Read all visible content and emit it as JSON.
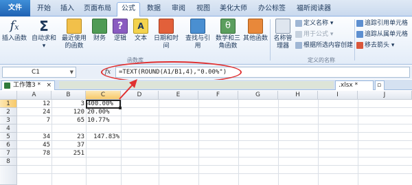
{
  "ribbon_tabs": [
    "文件",
    "开始",
    "插入",
    "页面布局",
    "公式",
    "数据",
    "审阅",
    "视图",
    "美化大师",
    "办公标签",
    "福昕阅读器"
  ],
  "active_tab": "公式",
  "ribbon": {
    "buttons": [
      {
        "label": "插入函数",
        "icon": "fx-icon"
      },
      {
        "label": "自动求和",
        "icon": "sigma-icon"
      },
      {
        "label": "最近使用的函数",
        "icon": "star-book-icon"
      },
      {
        "label": "财务",
        "icon": "money-book-icon"
      },
      {
        "label": "逻辑",
        "icon": "question-book-icon"
      },
      {
        "label": "文本",
        "icon": "text-book-icon"
      },
      {
        "label": "日期和时间",
        "icon": "clock-book-icon"
      },
      {
        "label": "查找与引用",
        "icon": "search-book-icon"
      },
      {
        "label": "数学和三角函数",
        "icon": "theta-book-icon"
      },
      {
        "label": "其他函数",
        "icon": "more-book-icon"
      },
      {
        "label": "名称管理器",
        "icon": "name-manager-icon"
      }
    ],
    "group_function_library": "函数库",
    "group_defined_names": "定义的名称",
    "define_name": "定义名称",
    "use_in_formula": "用于公式",
    "create_from_selection": "根据所选内容创建",
    "trace_precedents": "追踪引用单元格",
    "trace_dependents": "追踪从属单元格",
    "remove_arrows": "移去箭头"
  },
  "formula_bar": {
    "name_box": "C1",
    "fx_label": "fx",
    "formula": "=TEXT(ROUND(A1/B1,4),\"0.00%\")"
  },
  "workbook_tabs": [
    {
      "label": "工作簿3 *"
    },
    {
      "label": ".xlsx *"
    }
  ],
  "sheet": {
    "columns": [
      "A",
      "B",
      "C",
      "D",
      "E",
      "F",
      "G",
      "H",
      "I",
      "J"
    ],
    "rows": [
      "1",
      "2",
      "3",
      "4",
      "5",
      "6",
      "7",
      "8"
    ],
    "cells": [
      {
        "ref": "A1",
        "value": "12"
      },
      {
        "ref": "B1",
        "value": "3"
      },
      {
        "ref": "C1",
        "value": "400.00%"
      },
      {
        "ref": "A2",
        "value": "24"
      },
      {
        "ref": "B2",
        "value": "120"
      },
      {
        "ref": "C2",
        "value": "20.00%"
      },
      {
        "ref": "A3",
        "value": "7"
      },
      {
        "ref": "B3",
        "value": "65"
      },
      {
        "ref": "C3",
        "value": "10.77%"
      },
      {
        "ref": "A5",
        "value": "34"
      },
      {
        "ref": "B5",
        "value": "23"
      },
      {
        "ref": "C5",
        "value": "147.83%"
      },
      {
        "ref": "A6",
        "value": "45"
      },
      {
        "ref": "B6",
        "value": "37"
      },
      {
        "ref": "A7",
        "value": "78"
      },
      {
        "ref": "B7",
        "value": "251"
      }
    ],
    "active_cell": "C1"
  },
  "colors": {
    "file_tab": "#2a6fc2",
    "annotation": "#e03030",
    "selection_header": "#f7c96a"
  }
}
